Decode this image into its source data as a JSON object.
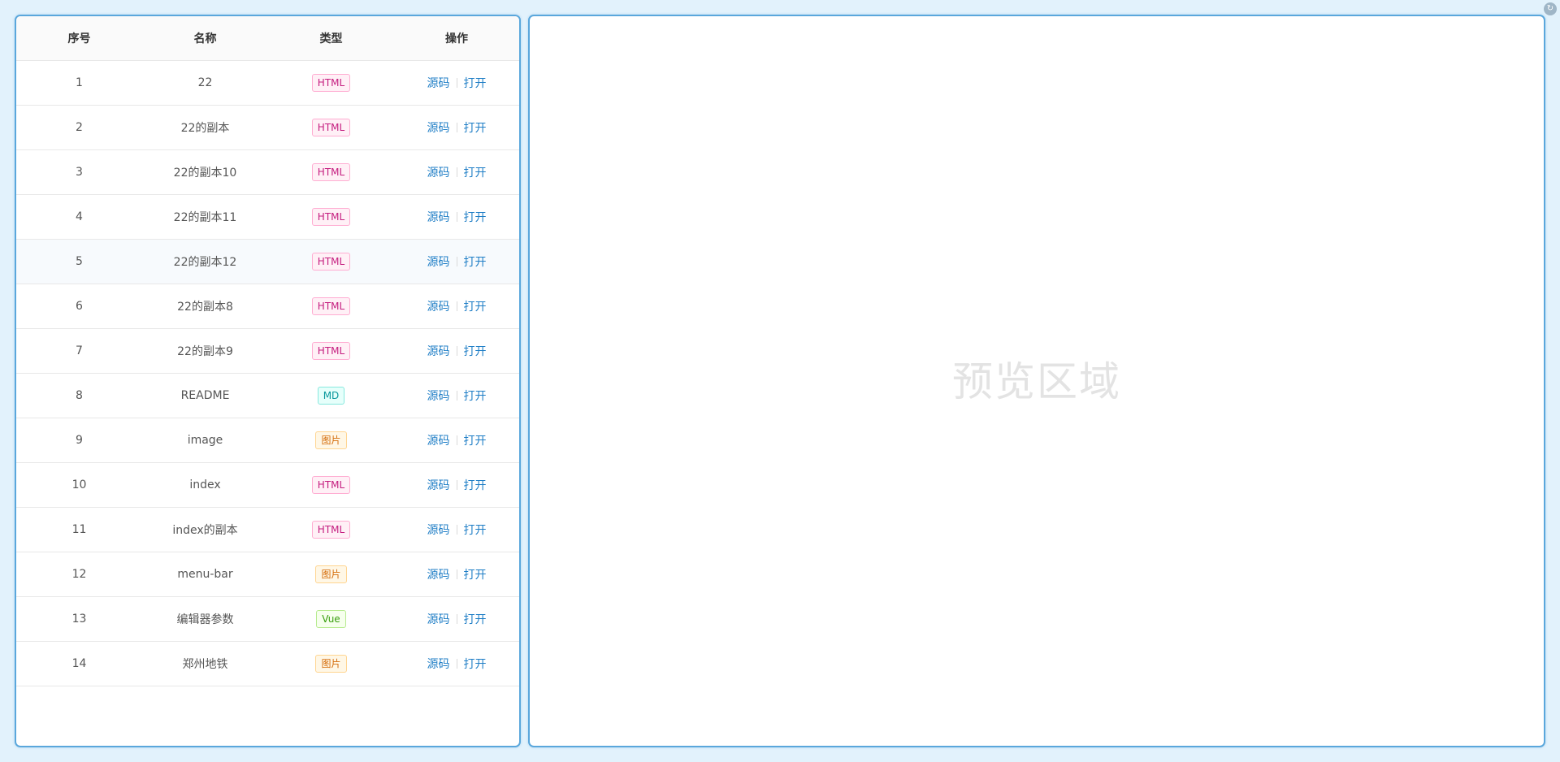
{
  "table": {
    "headers": [
      "序号",
      "名称",
      "类型",
      "操作"
    ],
    "rows": [
      {
        "index": "1",
        "name": "22",
        "type": "HTML",
        "type_kind": "html"
      },
      {
        "index": "2",
        "name": "22的副本",
        "type": "HTML",
        "type_kind": "html"
      },
      {
        "index": "3",
        "name": "22的副本10",
        "type": "HTML",
        "type_kind": "html"
      },
      {
        "index": "4",
        "name": "22的副本11",
        "type": "HTML",
        "type_kind": "html"
      },
      {
        "index": "5",
        "name": "22的副本12",
        "type": "HTML",
        "type_kind": "html"
      },
      {
        "index": "6",
        "name": "22的副本8",
        "type": "HTML",
        "type_kind": "html"
      },
      {
        "index": "7",
        "name": "22的副本9",
        "type": "HTML",
        "type_kind": "html"
      },
      {
        "index": "8",
        "name": "README",
        "type": "MD",
        "type_kind": "md"
      },
      {
        "index": "9",
        "name": "image",
        "type": "图片",
        "type_kind": "img"
      },
      {
        "index": "10",
        "name": "index",
        "type": "HTML",
        "type_kind": "html"
      },
      {
        "index": "11",
        "name": "index的副本",
        "type": "HTML",
        "type_kind": "html"
      },
      {
        "index": "12",
        "name": "menu-bar",
        "type": "图片",
        "type_kind": "img"
      },
      {
        "index": "13",
        "name": "编辑器参数",
        "type": "Vue",
        "type_kind": "vue"
      },
      {
        "index": "14",
        "name": "郑州地铁",
        "type": "图片",
        "type_kind": "img"
      }
    ],
    "actions": {
      "source": "源码",
      "open": "打开"
    }
  },
  "preview": {
    "placeholder": "预览区域"
  },
  "corner_button": {
    "icon": "refresh-icon",
    "glyph": "↻"
  },
  "colors": {
    "background": "#e2f2fc",
    "panel_border": "#5aa7dc",
    "link": "#1f7ec6",
    "placeholder": "#e3e3e3"
  }
}
